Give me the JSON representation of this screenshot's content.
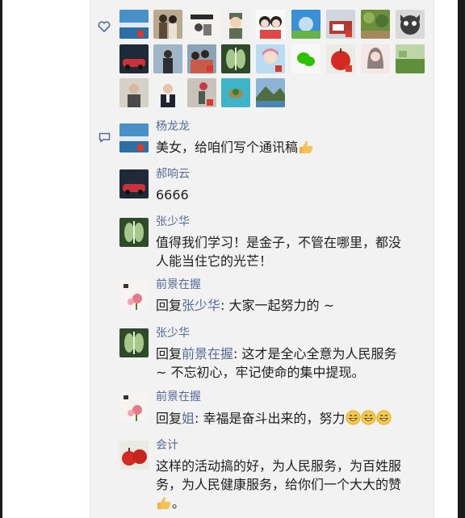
{
  "likes": {
    "icon": "heart-outline-icon",
    "avatars": [
      {
        "name": "liker-avatar-1",
        "desc": "blue-lake"
      },
      {
        "name": "liker-avatar-2",
        "desc": "couple-photo"
      },
      {
        "name": "liker-avatar-3",
        "desc": "calligraphy-figure"
      },
      {
        "name": "liker-avatar-4",
        "desc": "cartoon-soldier"
      },
      {
        "name": "liker-avatar-5",
        "desc": "cartoon-couple"
      },
      {
        "name": "liker-avatar-6",
        "desc": "sky-field"
      },
      {
        "name": "liker-avatar-7",
        "desc": "barn-sign"
      },
      {
        "name": "liker-avatar-8",
        "desc": "green-garden"
      },
      {
        "name": "liker-avatar-9",
        "desc": "cartoon-dog"
      },
      {
        "name": "liker-avatar-10",
        "desc": "red-car"
      },
      {
        "name": "liker-avatar-11",
        "desc": "person-outdoors"
      },
      {
        "name": "liker-avatar-12",
        "desc": "family-photo"
      },
      {
        "name": "liker-avatar-13",
        "desc": "chest-xray"
      },
      {
        "name": "liker-avatar-14",
        "desc": "cartoon-girl"
      },
      {
        "name": "liker-avatar-15",
        "desc": "wechat-logo"
      },
      {
        "name": "liker-avatar-16",
        "desc": "red-apples"
      },
      {
        "name": "liker-avatar-17",
        "desc": "woman-portrait"
      },
      {
        "name": "liker-avatar-18",
        "desc": "green-field"
      },
      {
        "name": "liker-avatar-19",
        "desc": "elderly-man"
      },
      {
        "name": "liker-avatar-20",
        "desc": "man-portrait"
      },
      {
        "name": "liker-avatar-21",
        "desc": "flower-vase"
      },
      {
        "name": "liker-avatar-22",
        "desc": "island"
      },
      {
        "name": "liker-avatar-23",
        "desc": "mountain-lake"
      }
    ]
  },
  "comments": {
    "icon": "comment-bubble-icon",
    "items": [
      {
        "name": "杨龙龙",
        "text": "美女，给咱们写个通讯稿",
        "avatar": "blue-lake",
        "emoji": "thumbs-up-icon"
      },
      {
        "name": "郝响云",
        "text": "6666",
        "avatar": "red-car"
      },
      {
        "name": "张少华",
        "text_line1": "值得我们学习！是金子，不管在哪里，都没",
        "text_line2": "人能当住它的光芒！",
        "avatar": "chest-xray"
      },
      {
        "name": "前景在握",
        "reply_prefix": "回复",
        "reply_to": "张少华",
        "text": ": 大家一起努力的 ~",
        "avatar": "calligraphy-flower"
      },
      {
        "name": "张少华",
        "reply_prefix": "回复",
        "reply_to": "前景在握",
        "text_line1": ": 这才是全心全意为人民服务",
        "text_line2": "~ 不忘初心，牢记使命的集中提现。",
        "avatar": "chest-xray"
      },
      {
        "name": "前景在握",
        "reply_prefix": "回复",
        "reply_to": "姐",
        "text": ": 幸福是奋斗出来的，努力",
        "avatar": "calligraphy-flower",
        "emoji": "grin-face-icon"
      },
      {
        "name": "会计",
        "text_line1": "这样的活动搞的好，为人民服务，为百姓服",
        "text_line2": "务，为人民健康服务，给你们一个大大的赞",
        "text_line3": "。",
        "avatar": "red-apples",
        "emoji": "thumbs-up-icon"
      }
    ]
  }
}
